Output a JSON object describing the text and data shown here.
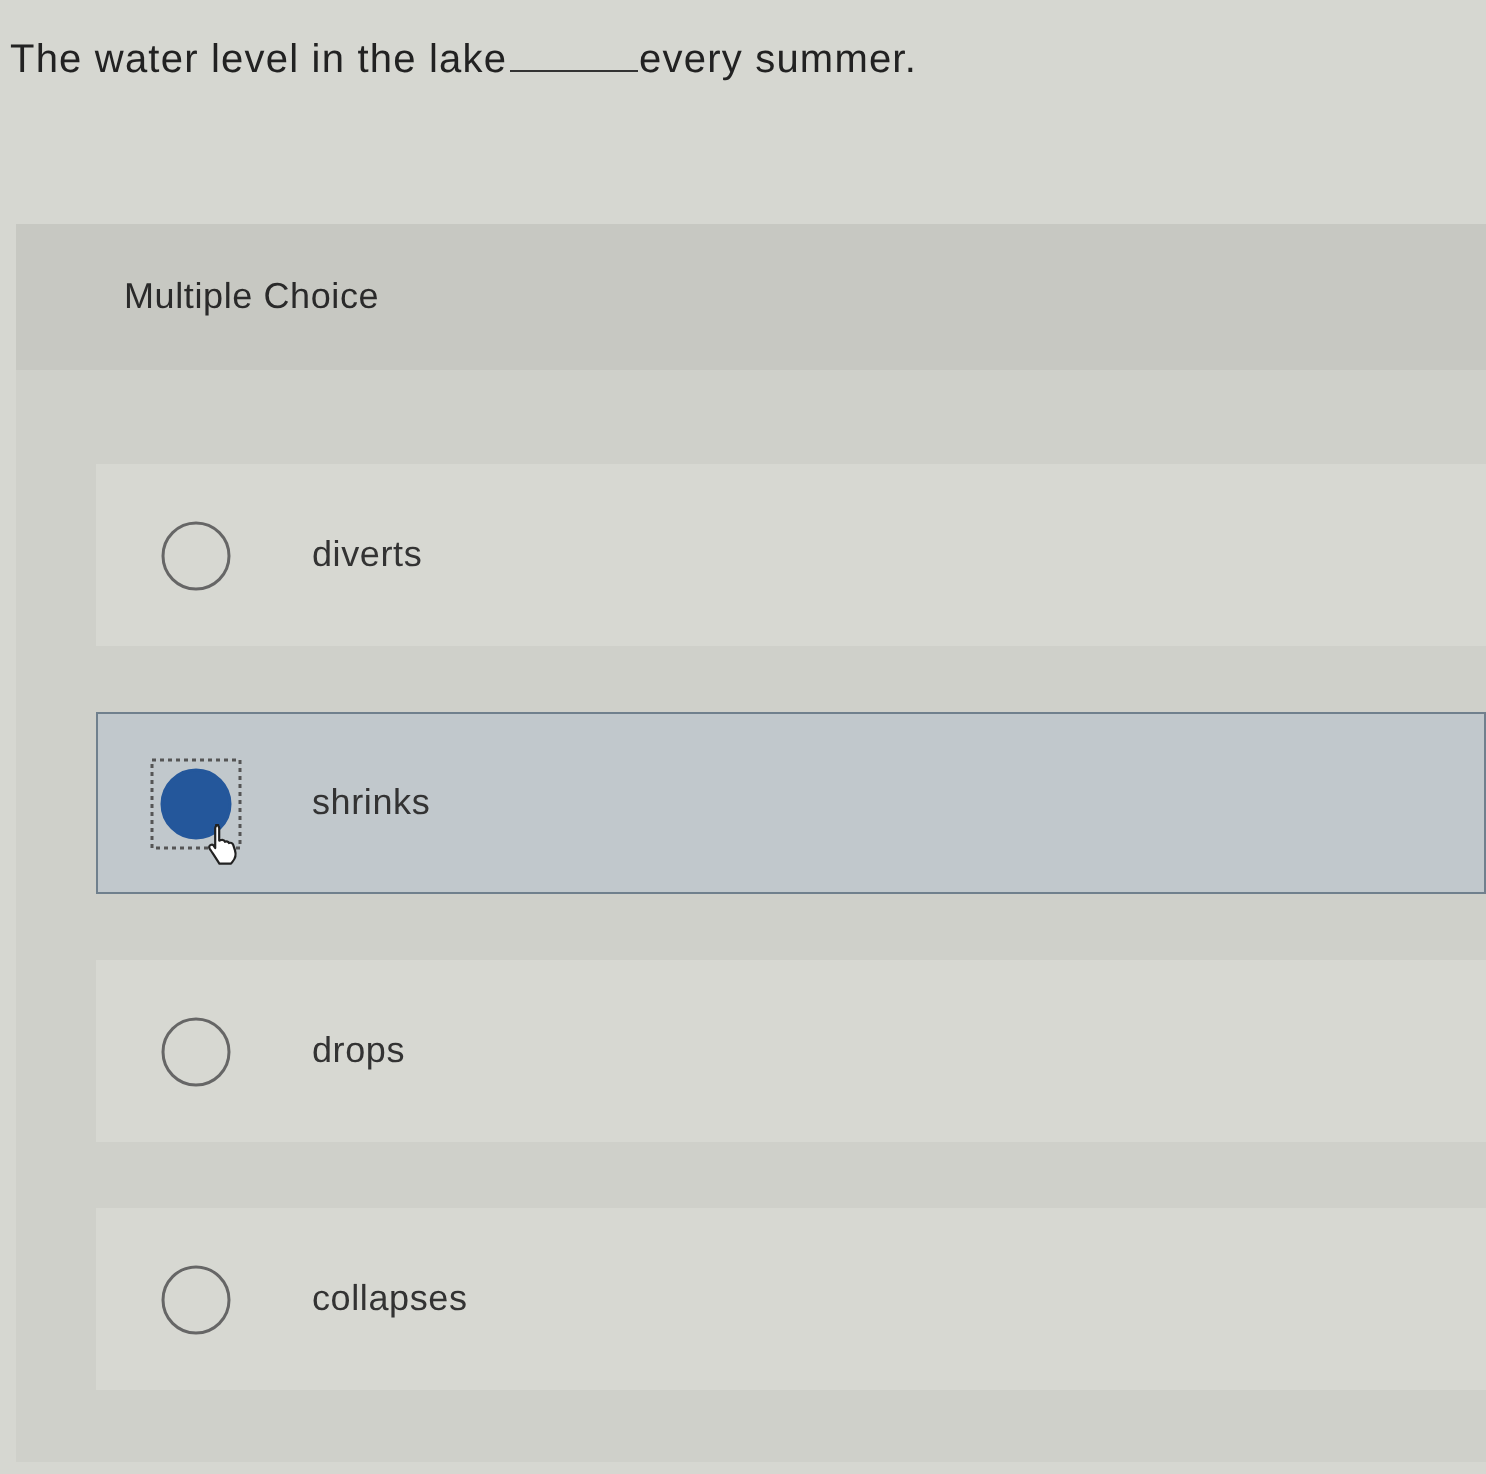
{
  "question": {
    "before": "The water level in the lake",
    "after": "every summer."
  },
  "panel": {
    "type": "Multiple Choice"
  },
  "options": [
    {
      "label": "diverts",
      "selected": false,
      "focused": false
    },
    {
      "label": "shrinks",
      "selected": true,
      "focused": true
    },
    {
      "label": "drops",
      "selected": false,
      "focused": false
    },
    {
      "label": "collapses",
      "selected": false,
      "focused": false
    }
  ]
}
